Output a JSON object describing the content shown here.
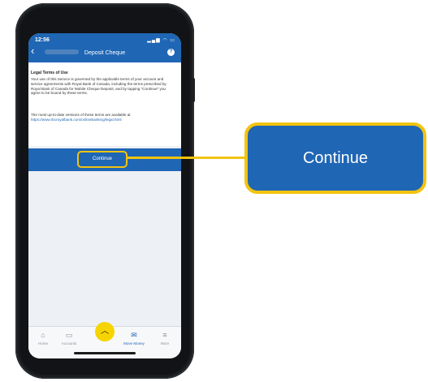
{
  "status": {
    "time": "12:56",
    "icons": "signal wifi battery"
  },
  "header": {
    "title": "Deposit Cheque",
    "help_icon": "?",
    "back_icon": "chevron-left"
  },
  "legal": {
    "heading": "Legal Terms of Use",
    "body": "Your use of this Service is governed by the applicable terms of your account and service agreements with Royal Bank of Canada, including the terms prescribed by Royal Bank of Canada for Mobile Cheque Deposit, and by tapping \"Continue\" you agree to be bound by these terms.",
    "versions_text": "The most up-to-date versions of these terms are available at",
    "link": "https://www.rbcroyalbank.com/onlinebanking/legal.html"
  },
  "continue_button": {
    "label": "Continue"
  },
  "callout": {
    "label": "Continue"
  },
  "bottom_nav": [
    {
      "label": "Home",
      "icon": "home-icon"
    },
    {
      "label": "Accounts",
      "icon": "accounts-icon"
    },
    {
      "label": "Move Money",
      "icon": "move-money-icon"
    },
    {
      "label": "More",
      "icon": "menu-icon"
    }
  ],
  "fab": {
    "icon": "chevron-up-icon"
  },
  "colors": {
    "brand_blue": "#1f66b5",
    "highlight_yellow": "#f2c30f",
    "fab_yellow": "#f6d400"
  }
}
